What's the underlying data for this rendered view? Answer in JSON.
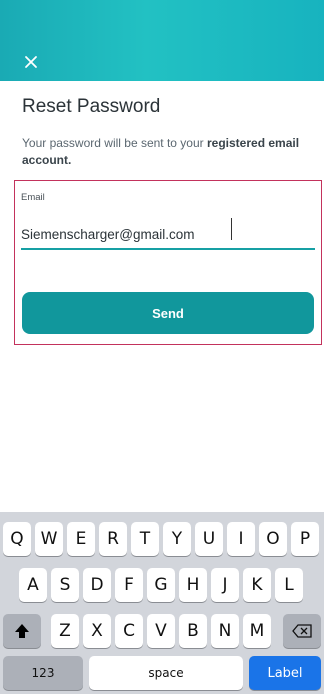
{
  "screen": {
    "title": "Reset Password",
    "desc_prefix": "Your password will be sent to your ",
    "desc_bold": "registered email account.",
    "email_label": "Email",
    "email_value": "Siemenscharger@gmail.com",
    "send_label": "Send"
  },
  "keyboard": {
    "row1": [
      "Q",
      "W",
      "E",
      "R",
      "T",
      "Y",
      "U",
      "I",
      "O",
      "P"
    ],
    "row2": [
      "A",
      "S",
      "D",
      "F",
      "G",
      "H",
      "J",
      "K",
      "L"
    ],
    "row3": [
      "Z",
      "X",
      "C",
      "V",
      "B",
      "N",
      "M"
    ],
    "numbers_label": "123",
    "space_label": "space",
    "action_label": "Label"
  },
  "colors": {
    "header": "#1fb8bf",
    "primary": "#11979c",
    "focus_outline": "#c3325c",
    "keyboard_bg": "#d2d5db",
    "action_key": "#1a74e8"
  },
  "icons": {
    "close": "close-icon",
    "shift": "shift-icon",
    "backspace": "backspace-icon"
  }
}
